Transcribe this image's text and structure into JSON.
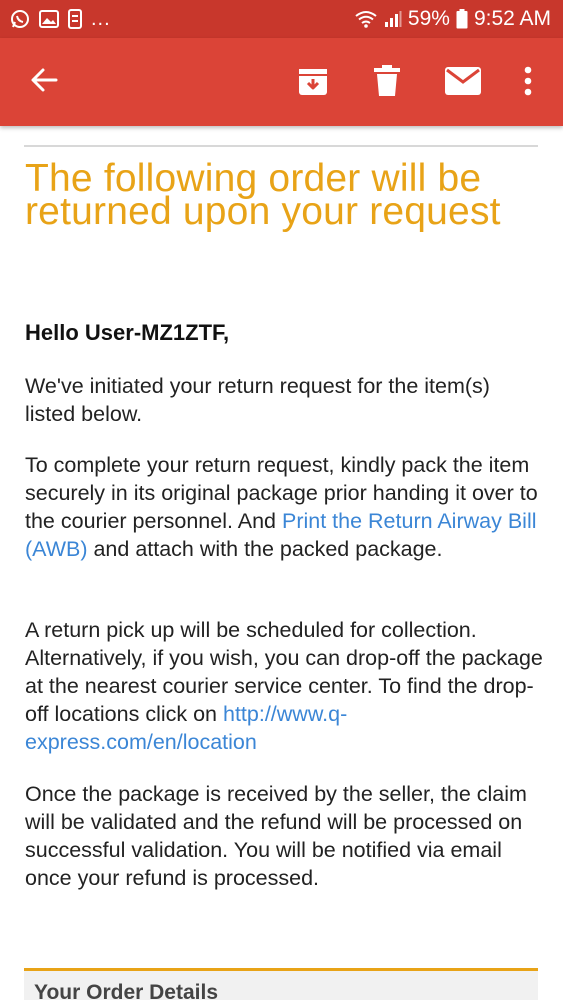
{
  "status_bar": {
    "dots": "...",
    "battery_percent": "59%",
    "time": "9:52 AM"
  },
  "toolbar": {
    "icons": [
      "back-arrow-icon",
      "archive-icon",
      "delete-icon",
      "mail-icon",
      "more-vert-icon"
    ]
  },
  "email": {
    "headline": "The following order will be returned upon your request",
    "greeting": "Hello User-MZ1ZTF,",
    "p1": "We've initiated your return request for the item(s) listed below.",
    "p2_text_a": "To complete your return request, kindly pack the item securely in its original package prior handing it over to the courier personnel. And ",
    "p2_link": "Print the Return Airway Bill (AWB)",
    "p2_text_b": " and attach with the packed package.",
    "p3_text": "A return pick up will be scheduled for collection. Alternatively, if you wish, you can drop-off the package at the nearest courier service center. To find the drop-off locations click on ",
    "p3_link": "http://www.q-express.com/en/location",
    "p4": "Once the package is received by the seller, the claim will be validated and the refund will be processed on successful validation. You will be notified via email once your refund is processed.",
    "order_details_title": "Your Order Details"
  },
  "colors": {
    "status_bar": "#c8372c",
    "toolbar": "#db4437",
    "headline": "#e8a317",
    "link": "#3b86d6"
  }
}
